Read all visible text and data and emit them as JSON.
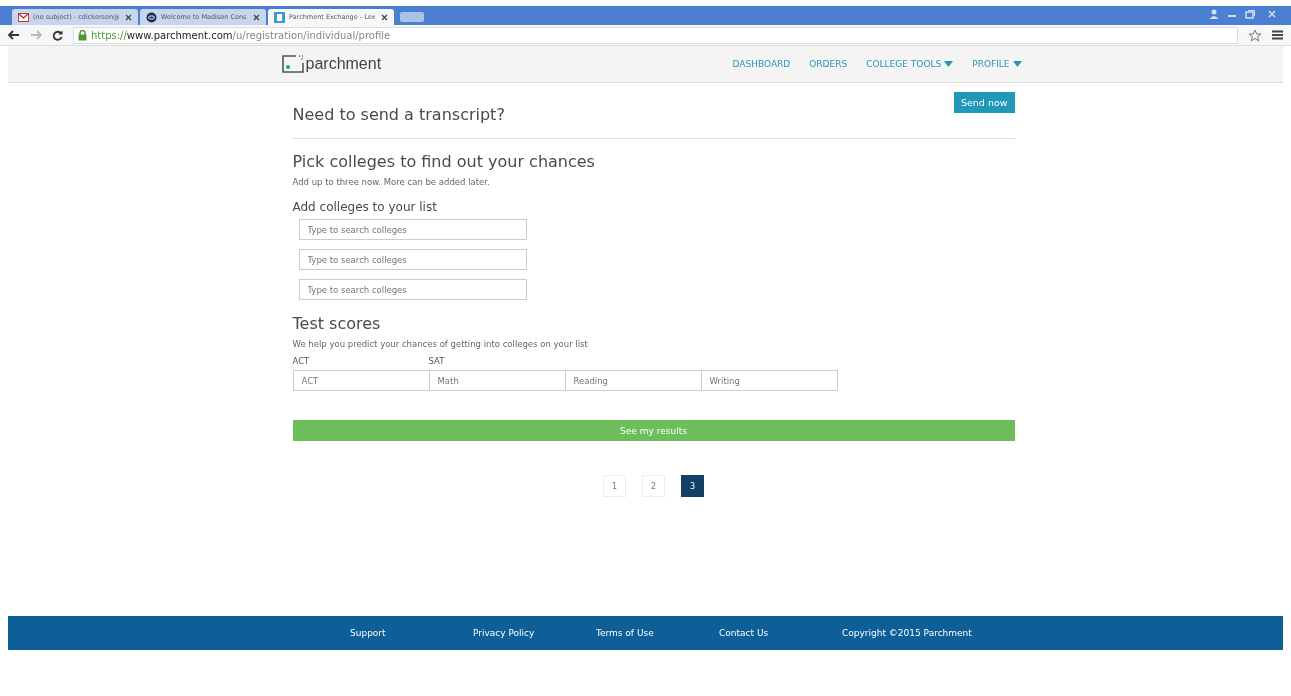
{
  "browser": {
    "tabs": [
      {
        "title": "(no subject) - cdickerson@",
        "selected": false
      },
      {
        "title": "Welcome to Madison Cons",
        "selected": false
      },
      {
        "title": "Parchment Exchange - Lex",
        "selected": true
      }
    ],
    "url": {
      "scheme": "https://",
      "host": "www.parchment.com",
      "path": "/u/registration/individual/profile"
    }
  },
  "header": {
    "logo": "parchment",
    "nav": [
      {
        "label": "DASHBOARD",
        "dropdown": false
      },
      {
        "label": "ORDERS",
        "dropdown": false
      },
      {
        "label": "COLLEGE TOOLS",
        "dropdown": true
      },
      {
        "label": "PROFILE",
        "dropdown": true
      }
    ]
  },
  "transcript": {
    "title": "Need to send a transcript?",
    "button": "Send now"
  },
  "colleges": {
    "title": "Pick colleges to find out your chances",
    "subtitle": "Add up to three now. More can be added later.",
    "list_label": "Add colleges to your list",
    "fields": [
      {
        "placeholder": "Type to search colleges"
      },
      {
        "placeholder": "Type to search colleges"
      },
      {
        "placeholder": "Type to search colleges"
      }
    ]
  },
  "test_scores": {
    "title": "Test scores",
    "subtitle": "We help you predict your chances of getting into colleges on your list",
    "groups": [
      {
        "label": "ACT",
        "fields": [
          {
            "placeholder": "ACT"
          }
        ]
      },
      {
        "label": "SAT",
        "fields": [
          {
            "placeholder": "Math"
          },
          {
            "placeholder": "Reading"
          },
          {
            "placeholder": "Writing"
          }
        ]
      }
    ]
  },
  "submit": "See my results",
  "pagination": [
    {
      "label": "1",
      "selected": false
    },
    {
      "label": "2",
      "selected": false
    },
    {
      "label": "3",
      "selected": true
    }
  ],
  "footer": [
    "Support",
    "Privacy Policy",
    "Terms of Use",
    "Contact Us",
    "Copyright ©2015 Parchment"
  ]
}
